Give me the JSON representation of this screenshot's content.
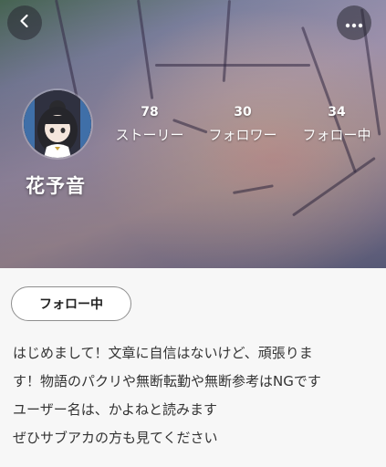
{
  "header": {
    "back_icon": "chevron-left-icon",
    "more_icon": "more-horizontal-icon"
  },
  "profile": {
    "name": "花予音",
    "stats": [
      {
        "value": "78",
        "label": "ストーリー"
      },
      {
        "value": "30",
        "label": "フォロワー"
      },
      {
        "value": "34",
        "label": "フォロー中"
      }
    ]
  },
  "follow_button": {
    "label": "フォロー中"
  },
  "bio": {
    "lines": [
      "はじめまして！文章に自信はないけど、頑張りま",
      "す！物語のパクリや無断転勤や無断参考はNGです",
      "ユーザー名は、かよねと読みます",
      "ぜひサブアカの方も見てください"
    ]
  },
  "colors": {
    "page_background": "#f7f7f7",
    "text": "#333333",
    "button_border": "#8e8e8e"
  }
}
